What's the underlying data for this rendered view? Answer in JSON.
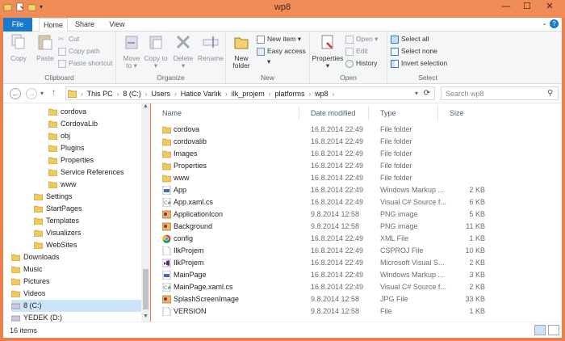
{
  "window": {
    "title": "wp8",
    "minimize": "—",
    "maximize": "☐",
    "close": "✕"
  },
  "tabs": [
    {
      "label": "File"
    },
    {
      "label": "Home"
    },
    {
      "label": "Share"
    },
    {
      "label": "View"
    }
  ],
  "ribbon": {
    "clipboard": {
      "label": "Clipboard",
      "copy": "Copy",
      "paste": "Paste",
      "cut": "Cut",
      "copy_path": "Copy path",
      "paste_shortcut": "Paste shortcut"
    },
    "organize": {
      "label": "Organize",
      "move_to": "Move to ▾",
      "copy_to": "Copy to ▾",
      "delete": "Delete ▾",
      "rename": "Rename"
    },
    "new": {
      "label": "New",
      "new_folder": "New folder",
      "new_item": "New item ▾",
      "easy_access": "Easy access ▾"
    },
    "open": {
      "label": "Open",
      "properties": "Properties ▾",
      "open": "Open ▾",
      "edit": "Edit",
      "history": "History"
    },
    "select": {
      "label": "Select",
      "select_all": "Select all",
      "select_none": "Select none",
      "invert": "Invert selection"
    }
  },
  "address": {
    "crumbs": [
      "This PC",
      "8 (C:)",
      "Users",
      "Hatice Varlık",
      "ilk_projem",
      "platforms",
      "wp8"
    ],
    "search_placeholder": "Search wp8"
  },
  "tree": [
    {
      "label": "cordova",
      "indent": 3
    },
    {
      "label": "CordovaLib",
      "indent": 3
    },
    {
      "label": "obj",
      "indent": 3
    },
    {
      "label": "Plugins",
      "indent": 3
    },
    {
      "label": "Properties",
      "indent": 3
    },
    {
      "label": "Service References",
      "indent": 3
    },
    {
      "label": "www",
      "indent": 3
    },
    {
      "label": "Settings",
      "indent": 2
    },
    {
      "label": "StartPages",
      "indent": 2
    },
    {
      "label": "Templates",
      "indent": 2
    },
    {
      "label": "Visualizers",
      "indent": 2
    },
    {
      "label": "WebSites",
      "indent": 2
    },
    {
      "label": "Downloads",
      "indent": 1
    },
    {
      "label": "Music",
      "indent": 1
    },
    {
      "label": "Pictures",
      "indent": 1
    },
    {
      "label": "Videos",
      "indent": 1
    },
    {
      "label": "8 (C:)",
      "indent": 1
    },
    {
      "label": "YEDEK (D:)",
      "indent": 1
    }
  ],
  "columns": {
    "name": "Name",
    "date": "Date modified",
    "type": "Type",
    "size": "Size"
  },
  "files": [
    {
      "name": "cordova",
      "date": "16.8.2014 22:49",
      "type": "File folder",
      "size": "",
      "icon": "folder-icon"
    },
    {
      "name": "cordovalib",
      "date": "16.8.2014 22:49",
      "type": "File folder",
      "size": "",
      "icon": "folder-icon"
    },
    {
      "name": "Images",
      "date": "16.8.2014 22:49",
      "type": "File folder",
      "size": "",
      "icon": "folder-icon"
    },
    {
      "name": "Properties",
      "date": "16.8.2014 22:49",
      "type": "File folder",
      "size": "",
      "icon": "folder-icon"
    },
    {
      "name": "www",
      "date": "16.8.2014 22:49",
      "type": "File folder",
      "size": "",
      "icon": "folder-icon"
    },
    {
      "name": "App",
      "date": "16.8.2014 22:49",
      "type": "Windows Markup ...",
      "size": "2 KB",
      "icon": "xaml-icon"
    },
    {
      "name": "App.xaml.cs",
      "date": "16.8.2014 22:49",
      "type": "Visual C# Source f...",
      "size": "6 KB",
      "icon": "csharp-icon"
    },
    {
      "name": "ApplicationIcon",
      "date": "9.8.2014 12:58",
      "type": "PNG image",
      "size": "5 KB",
      "icon": "image-icon"
    },
    {
      "name": "Background",
      "date": "9.8.2014 12:58",
      "type": "PNG image",
      "size": "11 KB",
      "icon": "image-icon"
    },
    {
      "name": "config",
      "date": "16.8.2014 22:49",
      "type": "XML File",
      "size": "1 KB",
      "icon": "chrome-icon"
    },
    {
      "name": "IlkProjem",
      "date": "16.8.2014 22:49",
      "type": "CSPROJ File",
      "size": "10 KB",
      "icon": "file-icon"
    },
    {
      "name": "IlkProjem",
      "date": "16.8.2014 22:49",
      "type": "Microsoft Visual S...",
      "size": "2 KB",
      "icon": "vs-icon"
    },
    {
      "name": "MainPage",
      "date": "16.8.2014 22:49",
      "type": "Windows Markup ...",
      "size": "3 KB",
      "icon": "xaml-icon"
    },
    {
      "name": "MainPage.xaml.cs",
      "date": "16.8.2014 22:49",
      "type": "Visual C# Source f...",
      "size": "2 KB",
      "icon": "csharp-icon"
    },
    {
      "name": "SplashScreenImage",
      "date": "9.8.2014 12:58",
      "type": "JPG File",
      "size": "33 KB",
      "icon": "image-icon"
    },
    {
      "name": "VERSION",
      "date": "9.8.2014 12:58",
      "type": "File",
      "size": "1 KB",
      "icon": "file-icon"
    }
  ],
  "status": {
    "count": "16 items"
  },
  "colors": {
    "accent": "#1979ca",
    "frame": "#ef8c58",
    "folder": "#e8c15a"
  }
}
